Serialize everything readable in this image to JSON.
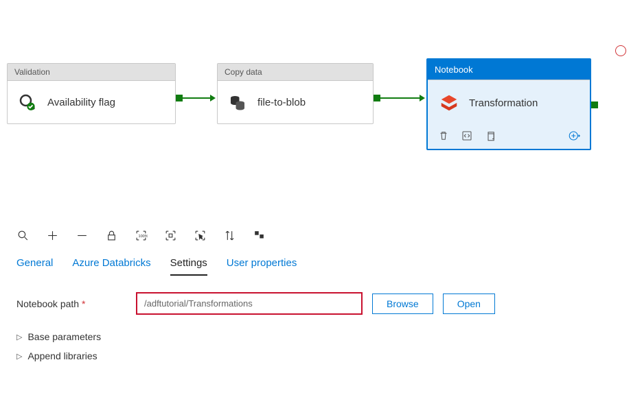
{
  "activities": {
    "validation": {
      "type": "Validation",
      "name": "Availability flag"
    },
    "copy": {
      "type": "Copy data",
      "name": "file-to-blob"
    },
    "notebook": {
      "type": "Notebook",
      "name": "Transformation"
    }
  },
  "tabs": {
    "general": "General",
    "databricks": "Azure Databricks",
    "settings": "Settings",
    "user": "User properties"
  },
  "settings": {
    "notebook_path_label": "Notebook path",
    "notebook_path_value": "/adftutorial/Transformations",
    "browse": "Browse",
    "open": "Open",
    "base_params": "Base parameters",
    "append_libs": "Append libraries"
  }
}
